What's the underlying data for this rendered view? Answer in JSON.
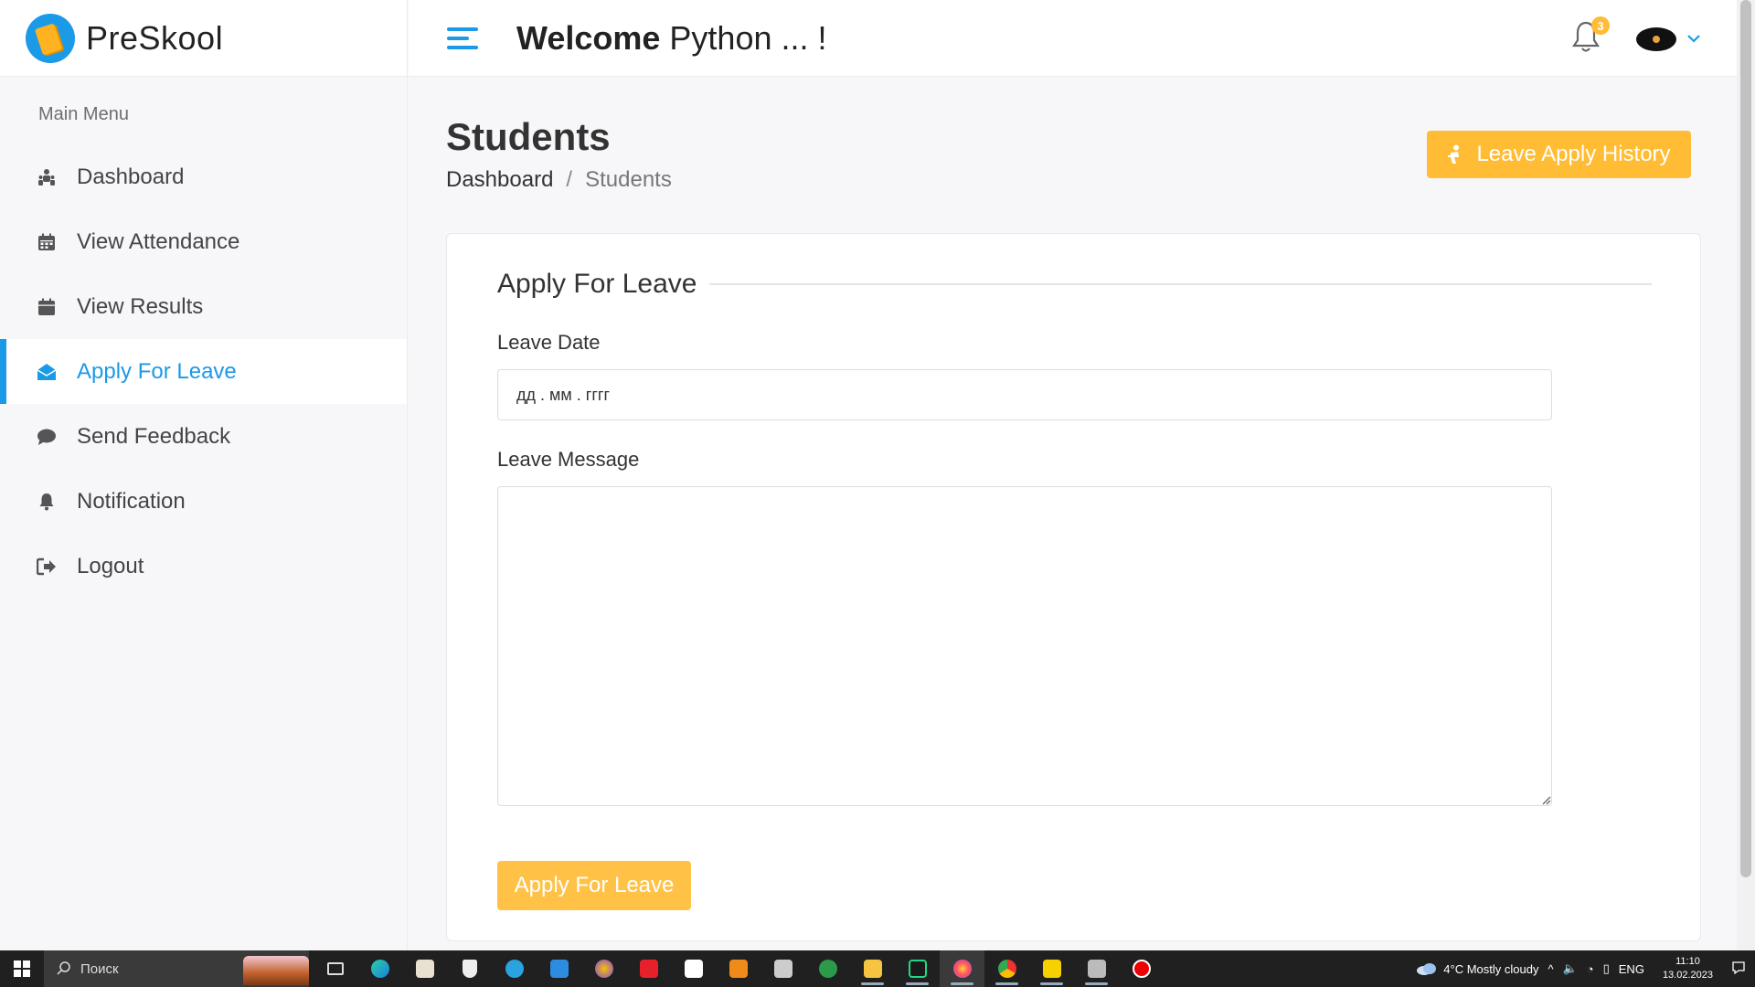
{
  "brand": {
    "name": "PreSkool"
  },
  "header": {
    "welcome_bold": "Welcome",
    "welcome_name": "Python ... !",
    "notification_count": "3"
  },
  "sidebar": {
    "title": "Main Menu",
    "items": [
      {
        "label": "Dashboard",
        "icon": "user-group-icon"
      },
      {
        "label": "View Attendance",
        "icon": "calendar-icon"
      },
      {
        "label": "View Results",
        "icon": "calendar-icon"
      },
      {
        "label": "Apply For Leave",
        "icon": "envelope-open-icon",
        "active": true
      },
      {
        "label": "Send Feedback",
        "icon": "comment-icon"
      },
      {
        "label": "Notification",
        "icon": "bell-icon"
      },
      {
        "label": "Logout",
        "icon": "logout-icon"
      }
    ]
  },
  "page": {
    "title": "Students",
    "breadcrumb": {
      "parent": "Dashboard",
      "separator": "/",
      "current": "Students"
    },
    "history_button": "Leave Apply History"
  },
  "form": {
    "title": "Apply For Leave",
    "date_label": "Leave Date",
    "date_placeholder": "дд . мм . гггг",
    "message_label": "Leave Message",
    "message_value": "",
    "submit_label": "Apply For Leave"
  },
  "taskbar": {
    "search_placeholder": "Поиск",
    "weather": "4°C  Mostly cloudy",
    "language": "ENG",
    "time": "11:10",
    "date": "13.02.2023"
  },
  "colors": {
    "accent": "#1b9ae8",
    "warning": "#ffbc34"
  }
}
